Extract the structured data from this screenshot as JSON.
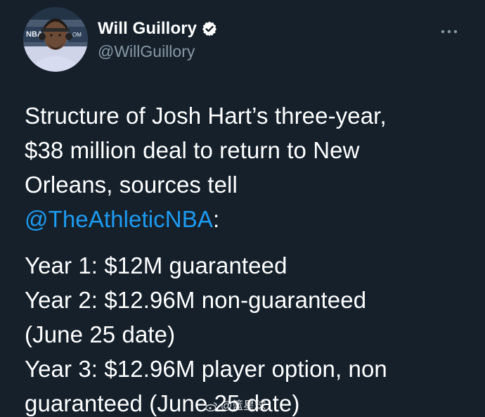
{
  "author": {
    "display_name": "Will Guillory",
    "handle": "@WillGuillory",
    "verified": true,
    "avatar_text": "NBA"
  },
  "tweet": {
    "lines_p1": [
      "Structure of Josh Hart’s three-year,",
      "$38 million deal to return to New",
      "Orleans, sources tell"
    ],
    "mention": "@TheAthleticNBA",
    "mention_suffix": ":",
    "lines_p2": [
      "Year 1: $12M guaranteed",
      "Year 2: $12.96M non-guaranteed",
      "(June 25 date)",
      "Year 3: $12.96M player option, non",
      "guaranteed (June 25 date)"
    ]
  },
  "watermark": {
    "text": "@篮星球"
  },
  "colors": {
    "background": "#15202b",
    "text": "#ffffff",
    "secondary": "#8899a6",
    "accent": "#1d9bf0"
  },
  "icons": {
    "verified": "verified-badge-icon",
    "more": "more-options-icon"
  }
}
